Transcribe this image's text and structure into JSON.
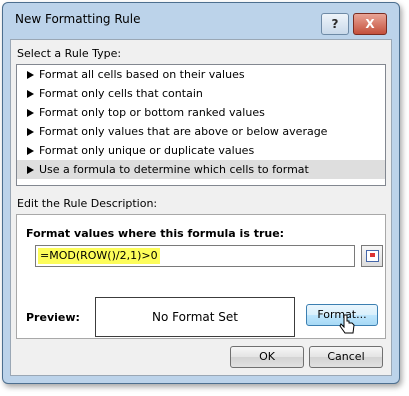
{
  "dialog": {
    "title": "New Formatting Rule",
    "help_label": "?",
    "close_label": "X"
  },
  "rule_type": {
    "label": "Select a Rule Type:",
    "items": [
      {
        "label": "Format all cells based on their values"
      },
      {
        "label": "Format only cells that contain"
      },
      {
        "label": "Format only top or bottom ranked values"
      },
      {
        "label": "Format only values that are above or below average"
      },
      {
        "label": "Format only unique or duplicate values"
      },
      {
        "label": "Use a formula to determine which cells to format",
        "selected": true
      }
    ]
  },
  "description": {
    "label": "Edit the Rule Description:",
    "formula_heading": "Format values where this formula is true:",
    "formula_value": "=MOD(ROW()/2,1)>0",
    "preview_label": "Preview:",
    "preview_text": "No Format Set",
    "format_button": "Format..."
  },
  "buttons": {
    "ok": "OK",
    "cancel": "Cancel"
  },
  "colors": {
    "formula_highlight": "#fdfd5a",
    "format_button_hover": "#bee6fd"
  }
}
